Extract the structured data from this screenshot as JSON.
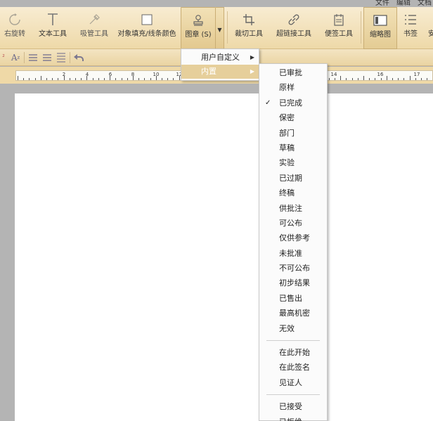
{
  "menubar": {
    "items": [
      "文件",
      "编辑",
      "文档"
    ]
  },
  "toolbar": {
    "rotate_right": "右旋转",
    "text_tool": "文本工具",
    "eyedropper": "吸管工具",
    "object_fill": "对象填充/线条颜色",
    "stamp": "图章 (S)",
    "crop": "裁切工具",
    "hyperlink": "超链接工具",
    "sticky_note": "便签工具",
    "thumbnail": "缩略图",
    "bookmark": "书签",
    "more": "安"
  },
  "format_bar": {
    "font_size_icon": "A",
    "undo_icon": "undo-icon"
  },
  "ruler": {
    "numbers": [
      "2",
      "4",
      "6",
      "8",
      "10",
      "12",
      "14",
      "16",
      "17"
    ]
  },
  "stamp_menu": {
    "items": [
      {
        "label": "用户自定义",
        "highlighted": false
      },
      {
        "label": "内置",
        "highlighted": true
      }
    ]
  },
  "builtin_menu": {
    "group1": [
      {
        "label": "已审批",
        "checked": false
      },
      {
        "label": "原样",
        "checked": false
      },
      {
        "label": "已完成",
        "checked": true
      },
      {
        "label": "保密",
        "checked": false
      },
      {
        "label": "部门",
        "checked": false
      },
      {
        "label": "草稿",
        "checked": false
      },
      {
        "label": "实验",
        "checked": false
      },
      {
        "label": "已过期",
        "checked": false
      },
      {
        "label": "终稿",
        "checked": false
      },
      {
        "label": "供批注",
        "checked": false
      },
      {
        "label": "可公布",
        "checked": false
      },
      {
        "label": "仅供参考",
        "checked": false
      },
      {
        "label": "未批准",
        "checked": false
      },
      {
        "label": "不可公布",
        "checked": false
      },
      {
        "label": "初步结果",
        "checked": false
      },
      {
        "label": "已售出",
        "checked": false
      },
      {
        "label": "最高机密",
        "checked": false
      },
      {
        "label": "无效",
        "checked": false
      }
    ],
    "group2": [
      {
        "label": "在此开始"
      },
      {
        "label": "在此签名"
      },
      {
        "label": "见证人"
      }
    ],
    "group3": [
      {
        "label": "已接受"
      },
      {
        "label": "已拒绝"
      }
    ],
    "check_mark": "✓"
  },
  "colors": {
    "ribbon_top": "#f8ecd2",
    "ribbon_bottom": "#eed9a8",
    "menu_highlight": "#e6cf9b",
    "workspace": "#b4b4b4"
  }
}
